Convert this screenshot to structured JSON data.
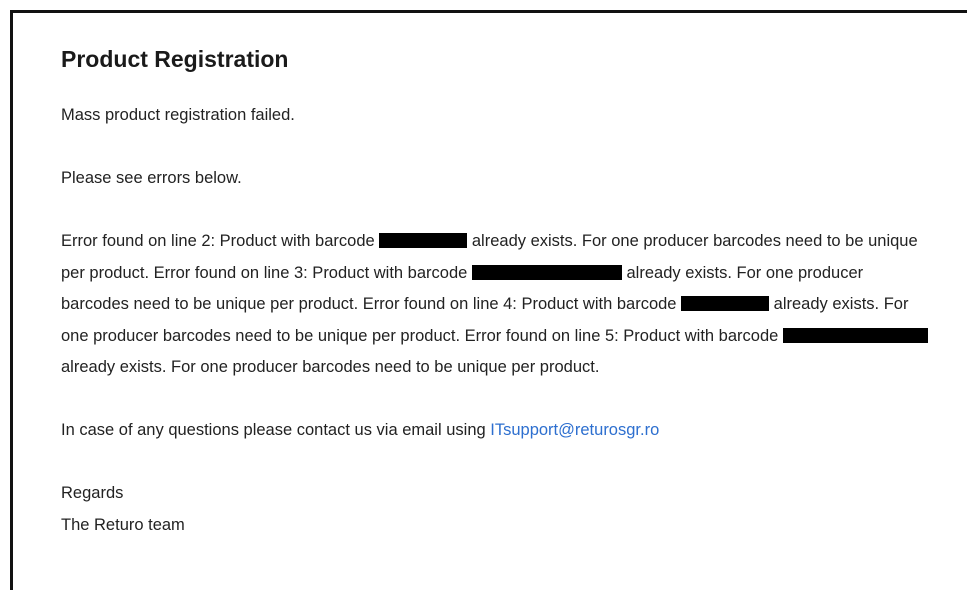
{
  "email": {
    "title": "Product Registration",
    "intro": "Mass product registration failed.",
    "see_errors": "Please see errors below.",
    "errors": {
      "e1_prefix": "Error found on line 2: Product with barcode",
      "e1_suffix": "already exists. For one producer barcodes need to be unique per product. Error found on line 3: Product with barcode",
      "e2_suffix": "already exists. For one producer barcodes need to be unique per product. Error found on line 4: Product with barcode",
      "e3_suffix": "already exists. For one producer barcodes need to be unique per product. Error found on line 5: Product with barcode",
      "e4_suffix": "already exists. For one producer barcodes need to be unique per product."
    },
    "contact_text": "In case of any questions please contact us via email using",
    "contact_email": "ITsupport@returosgr.ro",
    "regards": "Regards",
    "team": "The Returo team"
  },
  "colors": {
    "link": "#2d6fcf",
    "redaction": "#000000",
    "text": "#222222"
  }
}
